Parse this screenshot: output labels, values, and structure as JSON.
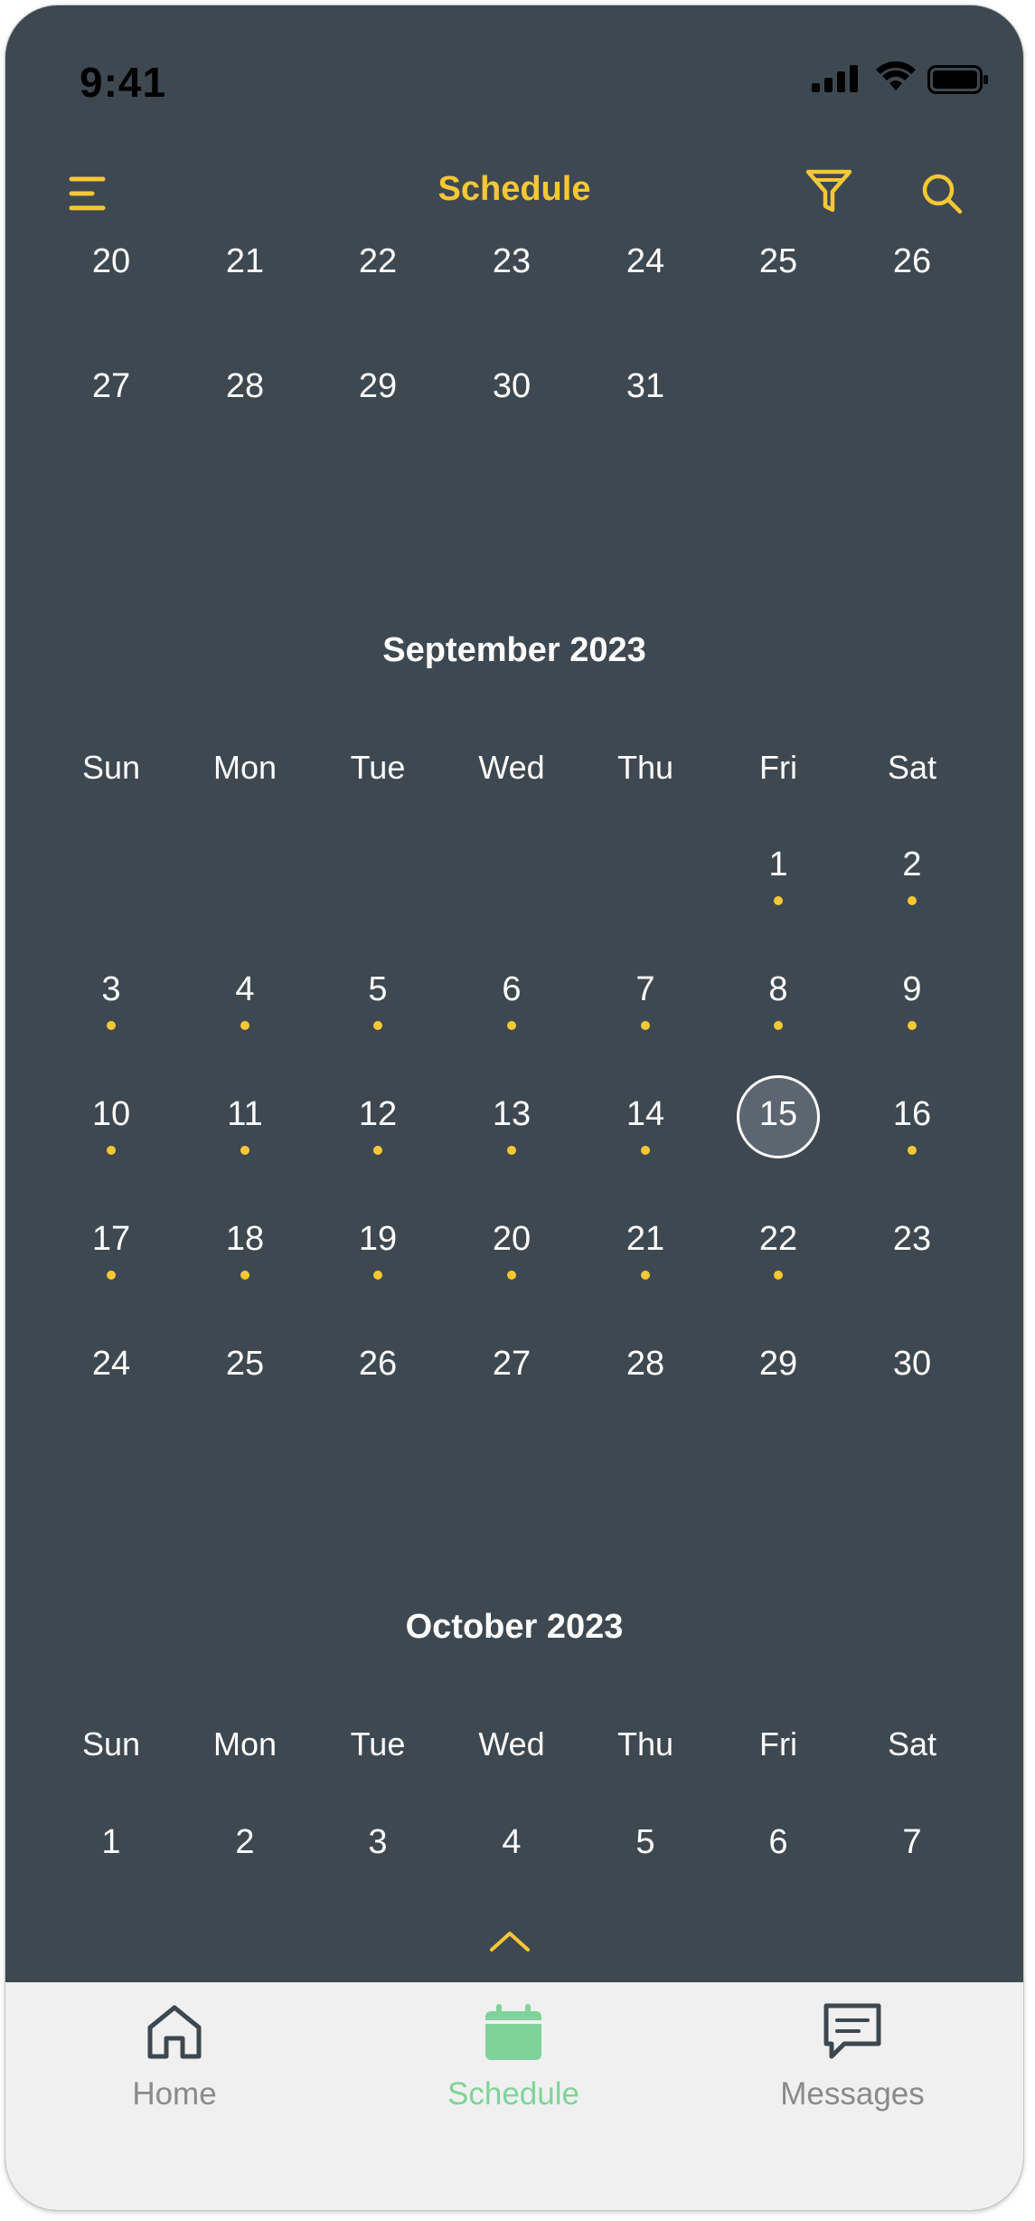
{
  "status_bar": {
    "time": "9:41"
  },
  "header": {
    "title": "Schedule"
  },
  "august_partial": {
    "weeks": [
      [
        "20",
        "21",
        "22",
        "23",
        "24",
        "25",
        "26"
      ],
      [
        "27",
        "28",
        "29",
        "30",
        "31",
        "",
        ""
      ]
    ]
  },
  "september": {
    "title": "September 2023",
    "weekdays": [
      "Sun",
      "Mon",
      "Tue",
      "Wed",
      "Thu",
      "Fri",
      "Sat"
    ],
    "weeks": [
      [
        "",
        "",
        "",
        "",
        "",
        "1",
        "2"
      ],
      [
        "3",
        "4",
        "5",
        "6",
        "7",
        "8",
        "9"
      ],
      [
        "10",
        "11",
        "12",
        "13",
        "14",
        "15",
        "16"
      ],
      [
        "17",
        "18",
        "19",
        "20",
        "21",
        "22",
        "23"
      ],
      [
        "24",
        "25",
        "26",
        "27",
        "28",
        "29",
        "30"
      ]
    ],
    "event_days": [
      "1",
      "2",
      "3",
      "4",
      "5",
      "6",
      "7",
      "8",
      "9",
      "10",
      "11",
      "12",
      "13",
      "14",
      "16",
      "17",
      "18",
      "19",
      "20",
      "21",
      "22"
    ],
    "selected_day": "15"
  },
  "october": {
    "title": "October 2023",
    "weekdays": [
      "Sun",
      "Mon",
      "Tue",
      "Wed",
      "Thu",
      "Fri",
      "Sat"
    ],
    "weeks": [
      [
        "1",
        "2",
        "3",
        "4",
        "5",
        "6",
        "7"
      ]
    ]
  },
  "tabs": [
    {
      "label": "Home",
      "icon": "home-icon",
      "active": false
    },
    {
      "label": "Schedule",
      "icon": "calendar-icon",
      "active": true
    },
    {
      "label": "Messages",
      "icon": "message-icon",
      "active": false
    }
  ],
  "colors": {
    "background": "#3e4850",
    "accent": "#f7c734",
    "active_tab": "#7fd39a",
    "tabbar": "#f0f0f0"
  }
}
